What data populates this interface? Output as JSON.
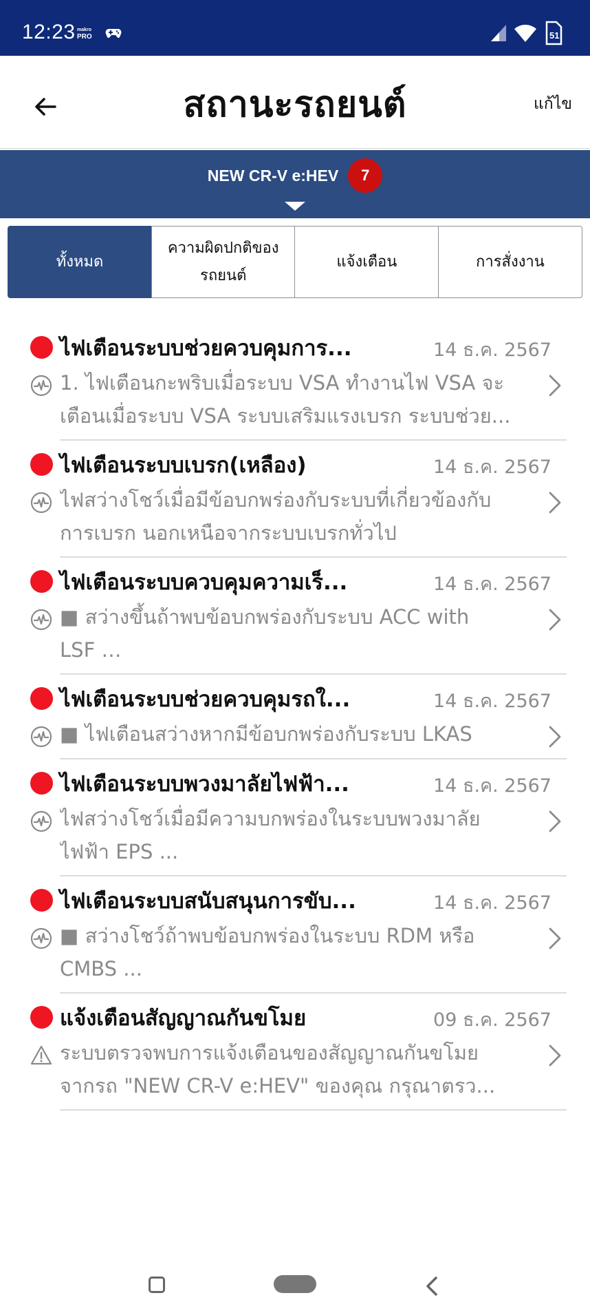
{
  "status_bar": {
    "time": "12:23",
    "brand_top": "makro",
    "brand_bottom": "PRO",
    "icons": [
      "gamepad-icon",
      "signal-icon",
      "wifi-icon",
      "sim-icon"
    ],
    "background": "#0e2a78"
  },
  "header": {
    "title": "สถานะรถยนต์",
    "edit_label": "แก้ไข",
    "back_icon": "arrow-left-icon"
  },
  "vehicle": {
    "name": "NEW CR-V e:HEV",
    "badge_count": "7",
    "background": "#2c4c82",
    "badge_color": "#cc1010"
  },
  "tabs": [
    {
      "label": "ทั้งหมด",
      "active": true
    },
    {
      "label_line1": "ความผิดปกติของ",
      "label_line2": "รถยนต์",
      "active": false
    },
    {
      "label": "แจ้งเตือน",
      "active": false
    },
    {
      "label": "การสั่งงาน",
      "active": false
    }
  ],
  "alerts": [
    {
      "title": "ไฟเตือนระบบช่วยควบคุมการ...",
      "date": "14 ธ.ค. 2567",
      "icon": "pulse-icon",
      "desc_line1": "1. ไฟเตือนกะพริบเมื่อระบบ VSA ทำงานไฟ VSA จะ",
      "desc_line2": "เตือนเมื่อระบบ VSA ระบบเสริมแรงเบรก ระบบช่วย..."
    },
    {
      "title": "ไฟเตือนระบบเบรก(เหลือง)",
      "date": "14 ธ.ค. 2567",
      "icon": "pulse-icon",
      "desc_line1": "ไฟสว่างโชว์เมื่อมีข้อบกพร่องกับระบบที่เกี่ยวข้องกับ",
      "desc_line2": "การเบรก นอกเหนือจากระบบเบรกทั่วไป"
    },
    {
      "title": "ไฟเตือนระบบควบคุมความเร็...",
      "date": "14 ธ.ค. 2567",
      "icon": "pulse-icon",
      "desc_line1": "■ สว่างขึ้นถ้าพบข้อบกพร่องกับระบบ ACC with",
      "desc_line2": "LSF …"
    },
    {
      "title": "ไฟเตือนระบบช่วยควบคุมรถใ...",
      "date": "14 ธ.ค. 2567",
      "icon": "pulse-icon",
      "desc_line1": "■ ไฟเตือนสว่างหากมีข้อบกพร่องกับระบบ LKAS",
      "desc_line2": ""
    },
    {
      "title": "ไฟเตือนระบบพวงมาลัยไฟฟ้า...",
      "date": "14 ธ.ค. 2567",
      "icon": "pulse-icon",
      "desc_line1": "ไฟสว่างโชว์เมื่อมีความบกพร่องในระบบพวงมาลัย",
      "desc_line2": "ไฟฟ้า EPS ..."
    },
    {
      "title": "ไฟเตือนระบบสนับสนุนการขับ...",
      "date": "14 ธ.ค. 2567",
      "icon": "pulse-icon",
      "desc_line1": "■ สว่างโชว์ถ้าพบข้อบกพร่องในระบบ RDM หรือ",
      "desc_line2": "CMBS ..."
    },
    {
      "title": "แจ้งเตือนสัญญาณกันขโมย",
      "date": "09 ธ.ค. 2567",
      "icon": "warning-triangle-icon",
      "desc_line1": "ระบบตรวจพบการแจ้งเตือนของสัญญาณกันขโมย",
      "desc_line2": "จากรถ \"NEW CR-V e:HEV\" ของคุณ กรุณาตรว..."
    }
  ],
  "colors": {
    "alert_dot": "#ef1522",
    "muted_text": "#8a8a8a"
  }
}
